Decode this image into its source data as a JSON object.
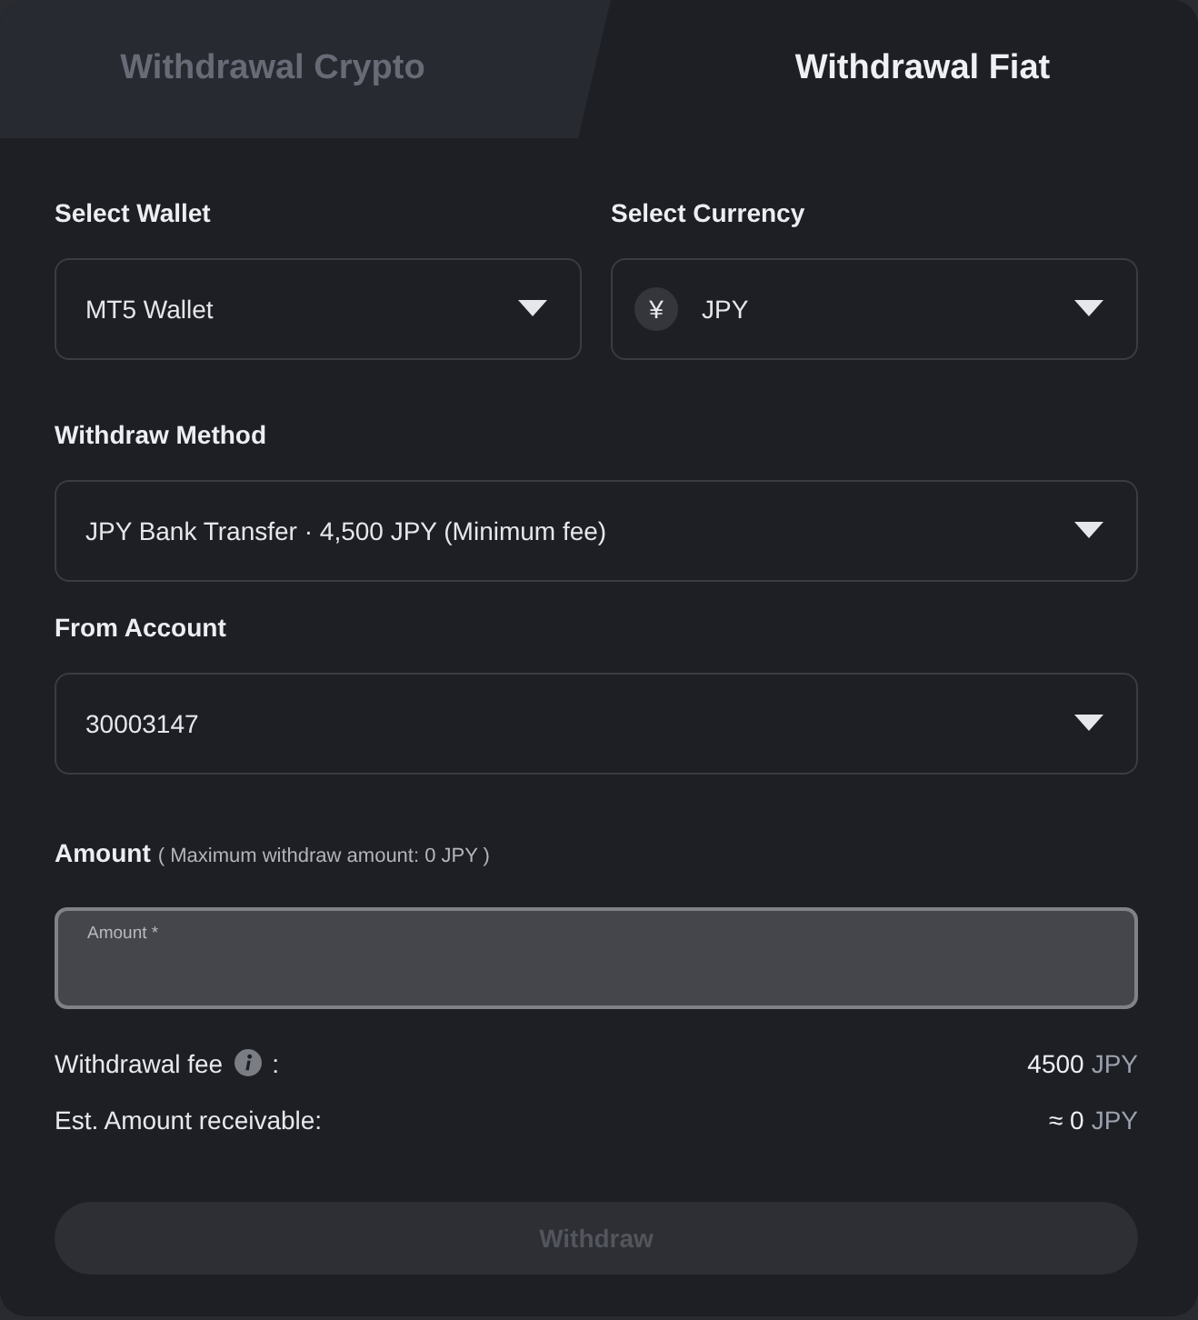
{
  "tabs": [
    {
      "label": "Withdrawal Crypto",
      "selected": false
    },
    {
      "label": "Withdrawal Fiat",
      "selected": true
    }
  ],
  "wallet": {
    "label": "Select Wallet",
    "value": "MT5 Wallet"
  },
  "currency": {
    "label": "Select Currency",
    "icon": "¥",
    "value": "JPY"
  },
  "withdraw_method": {
    "label": "Withdraw Method",
    "value": "JPY Bank Transfer · 4,500 JPY (Minimum fee)"
  },
  "from_account": {
    "label": "From Account",
    "value": "30003147"
  },
  "amount": {
    "label": "Amount",
    "note": "( Maximum withdraw amount: 0 JPY )",
    "placeholder": "Amount *"
  },
  "summary": [
    {
      "kind": "info",
      "label": "Withdrawal fee",
      "suffix": ":",
      "value": "4500",
      "unit": "JPY"
    },
    {
      "kind": "plain",
      "label": "Est. Amount receivable:",
      "value": "≈ 0",
      "unit": "JPY"
    }
  ],
  "button": {
    "label": "Withdraw",
    "disabled": true
  }
}
